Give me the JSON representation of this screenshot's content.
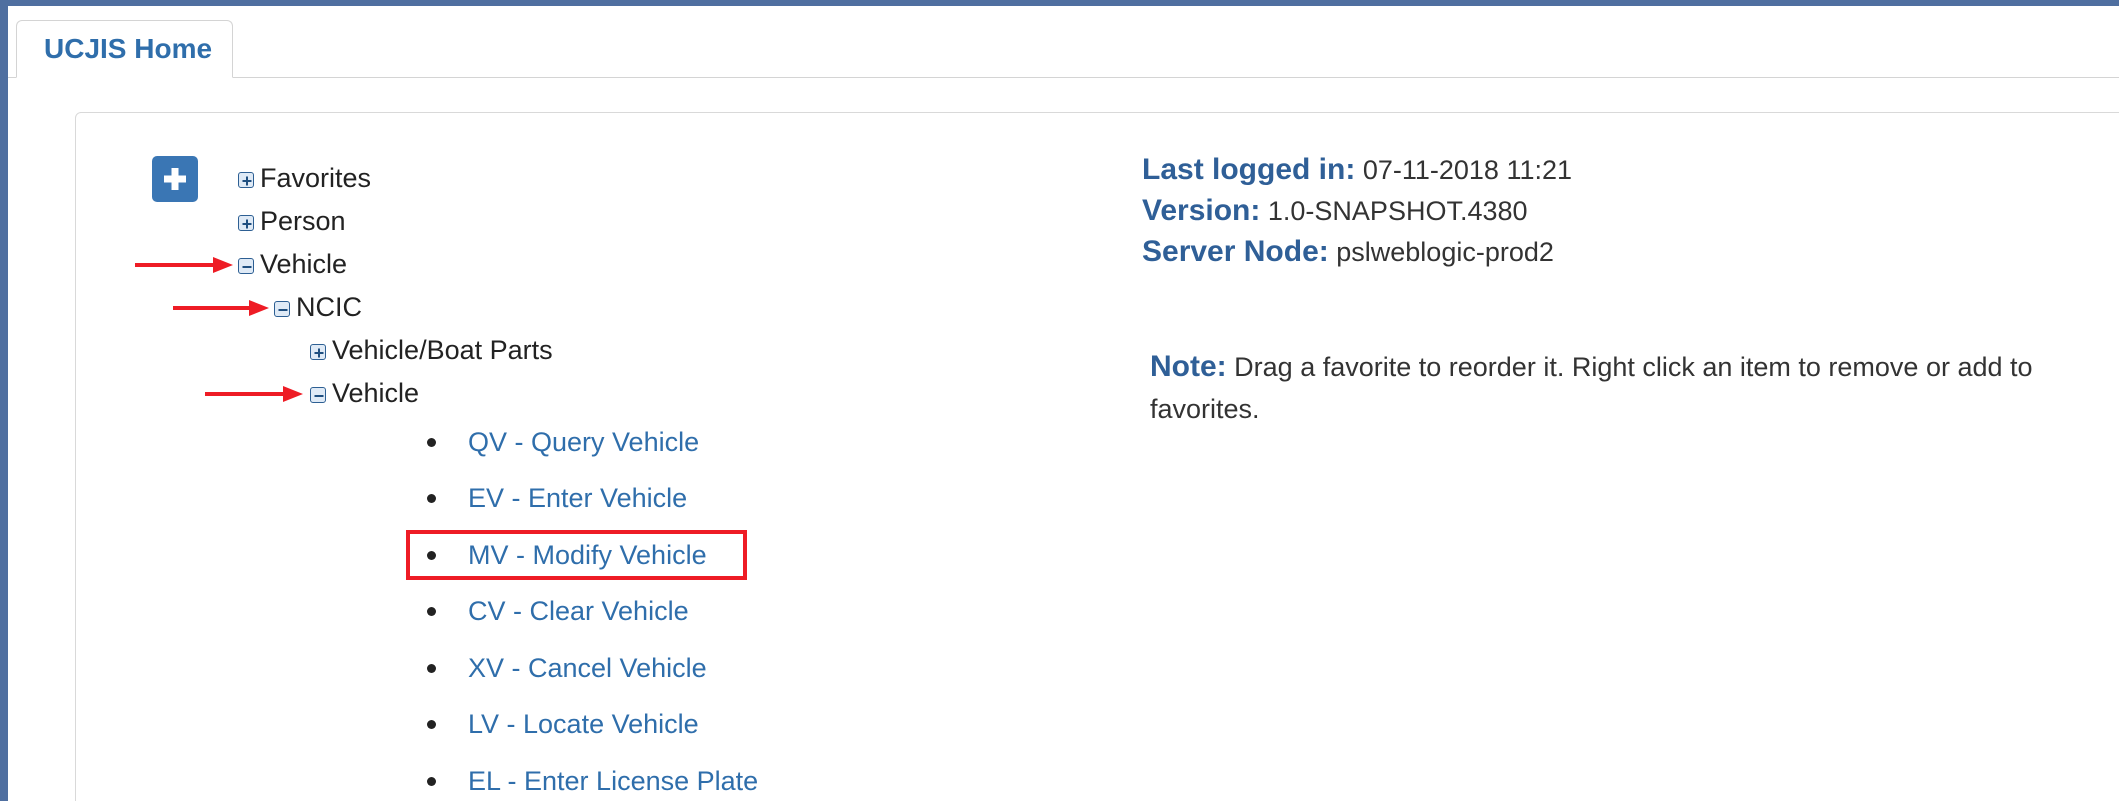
{
  "tabs": [
    {
      "label": "UCJIS Home"
    }
  ],
  "tree": {
    "items": [
      {
        "label": "Favorites",
        "state": "collapsed"
      },
      {
        "label": "Person",
        "state": "collapsed"
      },
      {
        "label": "Vehicle",
        "state": "expanded"
      },
      {
        "label": "NCIC",
        "state": "expanded"
      },
      {
        "label": "Vehicle/Boat Parts",
        "state": "collapsed"
      },
      {
        "label": "Vehicle",
        "state": "expanded"
      }
    ],
    "commands": [
      "QV - Query Vehicle",
      "EV - Enter Vehicle",
      "MV - Modify Vehicle",
      "CV - Clear Vehicle",
      "XV - Cancel Vehicle",
      "LV - Locate Vehicle",
      "EL - Enter License Plate"
    ]
  },
  "info": {
    "last_logged_label": "Last logged in:",
    "last_logged_value": "07-11-2018 11:21",
    "version_label": "Version:",
    "version_value": "1.0-SNAPSHOT.4380",
    "server_label": "Server Node:",
    "server_value": "pslweblogic-prod2"
  },
  "note": {
    "label": "Note:",
    "text": "Drag a favorite to reorder it. Right click an item to remove or add to favorites."
  },
  "colors": {
    "accent": "#2f6eab",
    "annotation": "#ee1c25",
    "frame": "#4f6fa0"
  },
  "icons": {
    "add": "plus-icon",
    "expand": "expand-plus-icon",
    "collapse": "collapse-minus-icon",
    "annotation": "red-arrow-icon"
  }
}
